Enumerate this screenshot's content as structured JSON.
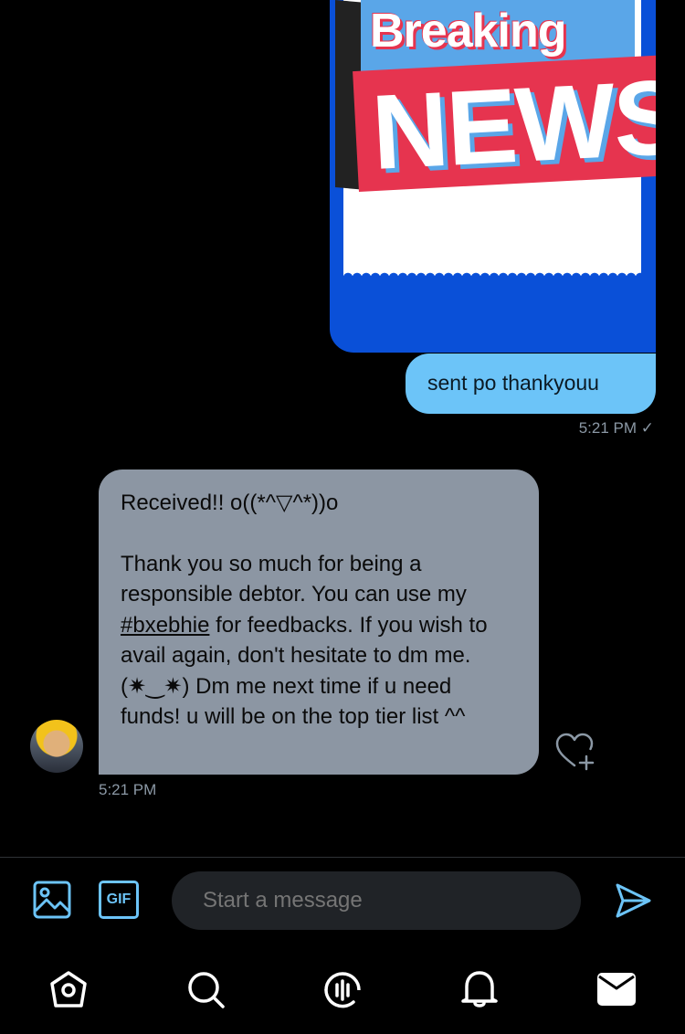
{
  "sent_media": {
    "image_text_top": "Breaking",
    "image_text_bottom": "NEWS"
  },
  "sent_message": {
    "text": "sent po thankyouu",
    "time": "5:21 PM ✓"
  },
  "received_message": {
    "line1": "Received!! o((*^▽^*))o",
    "para_before_hashtag": "Thank you so much for being a responsible debtor. You can use my ",
    "hashtag": "#bxebhie",
    "para_after_hashtag": " for feedbacks. If you wish to avail again, don't hesitate to dm me.(✷‿✷) Dm me next time if u need funds! u will be on the top tier list ^^",
    "time": "5:21 PM"
  },
  "composer": {
    "placeholder": "Start a message",
    "gif_label": "GIF"
  },
  "colors": {
    "accent": "#6cc4f8",
    "background": "#000000",
    "received_bubble": "#8c96a3",
    "input_bg": "#202327"
  },
  "icons": {
    "media": "image-icon",
    "gif": "gif-icon",
    "send": "send-icon",
    "react": "heart-plus-icon",
    "nav": [
      "home-icon",
      "search-icon",
      "spaces-icon",
      "notifications-icon",
      "messages-icon"
    ]
  }
}
